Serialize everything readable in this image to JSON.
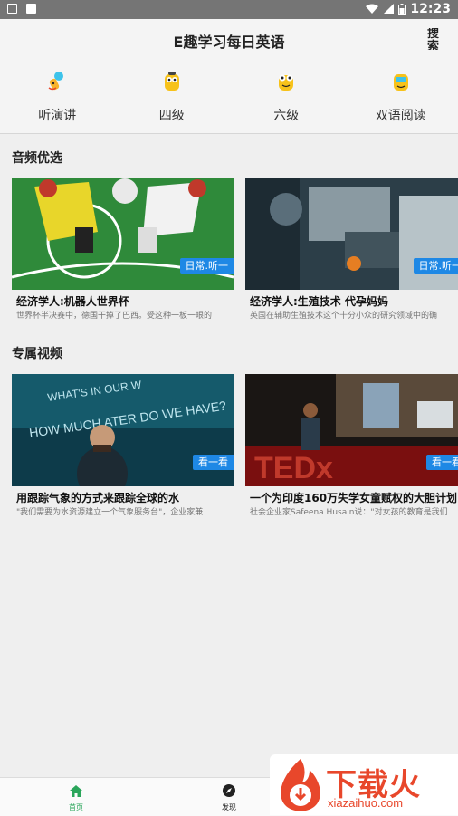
{
  "status_bar": {
    "time": "12:23"
  },
  "header": {
    "title": "E趣学习每日英语",
    "search_label": "搜索"
  },
  "quick_nav": [
    {
      "label": "听演讲",
      "icon": "microphone-icon"
    },
    {
      "label": "四级",
      "icon": "mascot-icon"
    },
    {
      "label": "六级",
      "icon": "mascot-icon"
    },
    {
      "label": "双语阅读",
      "icon": "mascot-icon"
    }
  ],
  "audio_section": {
    "title": "音频优选",
    "cards": [
      {
        "title": "经济学人:机器人世界杯",
        "desc": "世界杯半决赛中，德国干掉了巴西。受这种一板一眼的",
        "tag": "日常.听一"
      },
      {
        "title": "经济学人:生殖技术 代孕妈妈",
        "desc": "英国在辅助生殖技术这个十分小众的研究领域中的确",
        "tag": "日常.听一"
      }
    ]
  },
  "video_section": {
    "title": "专属视频",
    "cards": [
      {
        "title": "用跟踪气象的方式来跟踪全球的水",
        "desc": "\"我们需要为水资源建立一个气象服务台\"，企业家兼",
        "tag": "看一看"
      },
      {
        "title": "一个为印度160万失学女童赋权的大胆计划",
        "desc": "社会企业家Safeena Husain说：\"对女孩的教育是我们",
        "tag": "看一看"
      }
    ]
  },
  "bottom_nav": [
    {
      "label": "首页",
      "icon": "home-icon",
      "active": true
    },
    {
      "label": "发现",
      "icon": "compass-icon",
      "active": false
    }
  ],
  "watermark": {
    "text": "下载火",
    "url": "xiazaihuo.com"
  },
  "colors": {
    "accent": "#1e88e5",
    "active_tab": "#2aa55a",
    "brand_red": "#e8472b"
  }
}
